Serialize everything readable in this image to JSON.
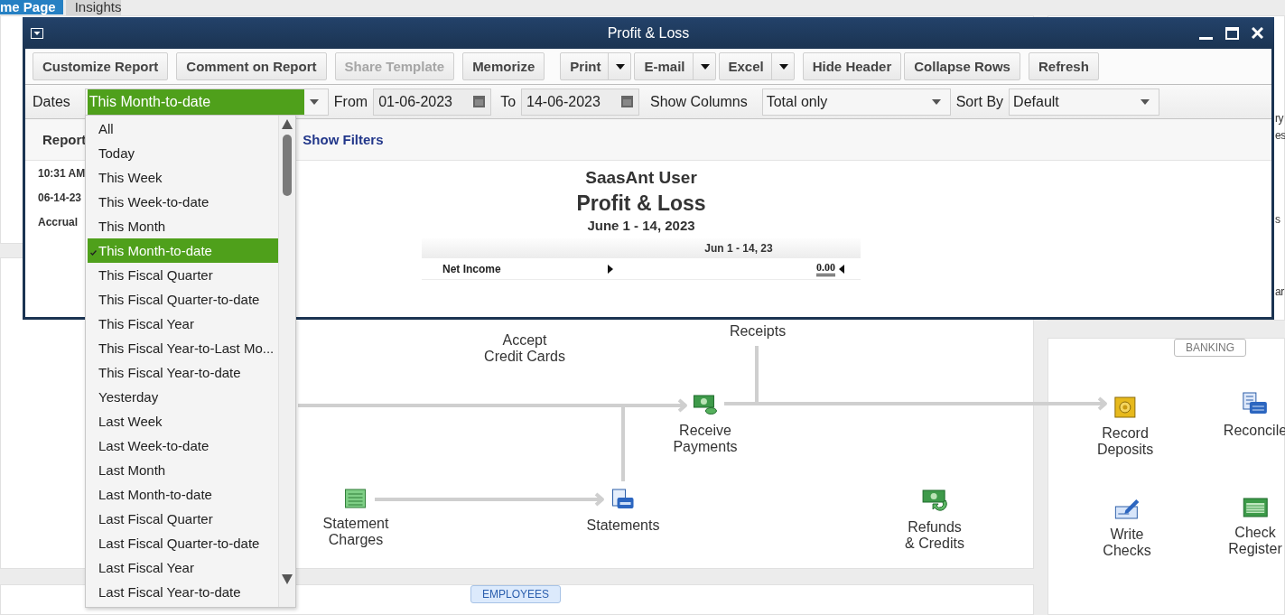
{
  "home_tabs": [
    {
      "label": "me Page",
      "selected": true
    },
    {
      "label": "Insights",
      "selected": false
    }
  ],
  "right_panel_fragments": [
    "ry",
    "es",
    "s",
    "ar"
  ],
  "flow": [
    {
      "kind": "card",
      "lines": [
        "Accept",
        "Credit Cards"
      ]
    },
    {
      "kind": "receipts",
      "lines": [
        "Receipts"
      ]
    },
    {
      "kind": "payment",
      "lines": [
        "Receive",
        "Payments"
      ]
    },
    {
      "kind": "charges",
      "lines": [
        "Statement",
        "Charges"
      ]
    },
    {
      "kind": "statements",
      "lines": [
        "Statements"
      ]
    },
    {
      "kind": "refund",
      "lines": [
        "Refunds",
        "& Credits"
      ]
    },
    {
      "kind": "deposit",
      "lines": [
        "Record",
        "Deposits"
      ]
    },
    {
      "kind": "reconcile",
      "lines": [
        "Reconcile"
      ]
    },
    {
      "kind": "write_checks",
      "lines": [
        "Write",
        "Checks"
      ]
    },
    {
      "kind": "register",
      "lines": [
        "Check",
        "Register"
      ]
    }
  ],
  "badges": {
    "employees": "EMPLOYEES",
    "banking": "BANKING"
  },
  "window": {
    "title": "Profit & Loss"
  },
  "toolbar": [
    [
      {
        "kind": "button",
        "label": "Customize Report",
        "disabled": false
      }
    ],
    [
      {
        "kind": "button",
        "label": "Comment on Report",
        "disabled": false
      }
    ],
    [
      {
        "kind": "button",
        "label": "Share Template",
        "disabled": true
      }
    ],
    [
      {
        "kind": "button",
        "label": "Memorize",
        "disabled": false
      }
    ],
    [
      {
        "kind": "split",
        "label": "Print",
        "disabled": false
      },
      {
        "kind": "split",
        "label": "E-mail",
        "disabled": false
      },
      {
        "kind": "split",
        "label": "Excel",
        "disabled": false
      }
    ],
    [
      {
        "kind": "button",
        "label": "Hide Header",
        "disabled": false
      },
      {
        "kind": "button",
        "label": "Collapse Rows",
        "disabled": false
      }
    ],
    [
      {
        "kind": "button",
        "label": "Refresh",
        "disabled": false
      }
    ]
  ],
  "filters": {
    "dates_label": "Dates",
    "dates_value": "This Month-to-date",
    "from_label": "From",
    "from": "01-06-2023",
    "to_label": "To",
    "to": "14-06-2023",
    "columns_label": "Show Columns",
    "columns_value": "Total only",
    "sort_label": "Sort By",
    "sort_value": "Default"
  },
  "report_bar": {
    "label": "Report",
    "filters_link": "Show Filters"
  },
  "report_meta": [
    "10:31 AM",
    "06-14-23",
    "Accrual"
  ],
  "report": {
    "company": "SaasAnt User",
    "title": "Profit & Loss",
    "period": "June 1 - 14, 2023",
    "column": "Jun 1 - 14, 23",
    "rows": [
      {
        "label": "Net Income",
        "value": "0.00"
      }
    ]
  },
  "date_menu": [
    {
      "label": "All",
      "selected": false
    },
    {
      "label": "Today",
      "selected": false
    },
    {
      "label": "This Week",
      "selected": false
    },
    {
      "label": "This Week-to-date",
      "selected": false
    },
    {
      "label": "This Month",
      "selected": false
    },
    {
      "label": "This Month-to-date",
      "selected": true
    },
    {
      "label": "This Fiscal Quarter",
      "selected": false
    },
    {
      "label": "This Fiscal Quarter-to-date",
      "selected": false
    },
    {
      "label": "This Fiscal Year",
      "selected": false
    },
    {
      "label": "This Fiscal Year-to-Last Mo...",
      "selected": false
    },
    {
      "label": "This Fiscal Year-to-date",
      "selected": false
    },
    {
      "label": "Yesterday",
      "selected": false
    },
    {
      "label": "Last Week",
      "selected": false
    },
    {
      "label": "Last Week-to-date",
      "selected": false
    },
    {
      "label": "Last Month",
      "selected": false
    },
    {
      "label": "Last Month-to-date",
      "selected": false
    },
    {
      "label": "Last Fiscal Quarter",
      "selected": false
    },
    {
      "label": "Last Fiscal Quarter-to-date",
      "selected": false
    },
    {
      "label": "Last Fiscal Year",
      "selected": false
    },
    {
      "label": "Last Fiscal Year-to-date",
      "selected": false
    }
  ]
}
